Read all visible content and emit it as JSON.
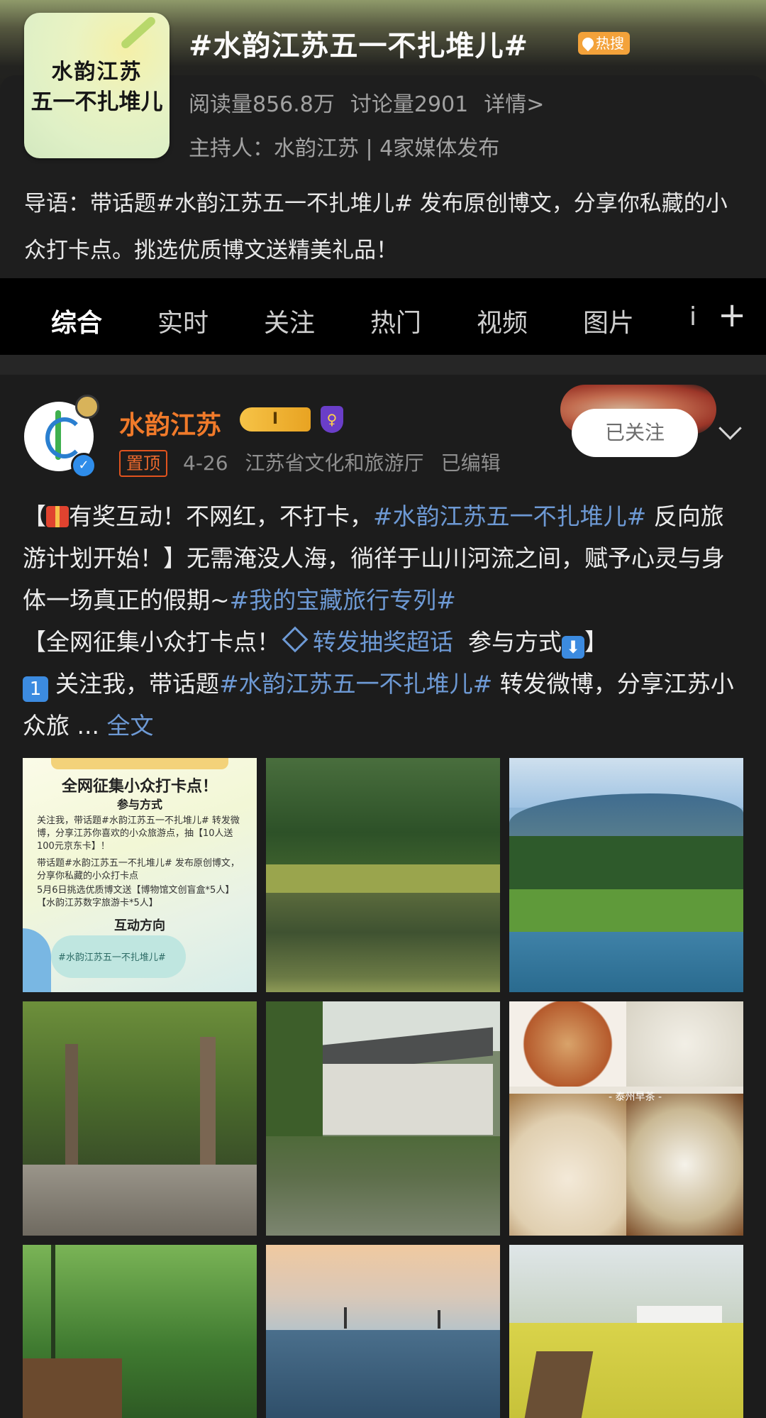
{
  "topic": {
    "cover_line1": "水韵江苏",
    "cover_line2": "五一不扎堆儿",
    "title": "#水韵江苏五一不扎堆儿#",
    "hot_badge": "热搜",
    "reads": "阅读量856.8万",
    "discussions": "讨论量2901",
    "details_link": "详情>",
    "host": "主持人：水韵江苏 | 4家媒体发布",
    "intro": "导语：带话题#水韵江苏五一不扎堆儿# 发布原创博文，分享你私藏的小众打卡点。挑选优质博文送精美礼品！"
  },
  "tabs": [
    {
      "label": "综合",
      "active": true
    },
    {
      "label": "实时"
    },
    {
      "label": "关注"
    },
    {
      "label": "热门"
    },
    {
      "label": "视频"
    },
    {
      "label": "图片"
    },
    {
      "label": "i"
    }
  ],
  "tabs_more": "+",
  "post": {
    "author": "水韵江苏",
    "crown_badge": "I",
    "follow_label": "已关注",
    "pinned_label": "置顶",
    "date": "4-26",
    "source": "江苏省文化和旅游厅",
    "edited": "已编辑",
    "text": {
      "p1_a": "【",
      "p1_b": "有奖互动！不网红，不打卡，",
      "p1_hashtag": "#水韵江苏五一不扎堆儿#",
      "p1_c": " 反向旅游计划开始！】无需淹没人海，徜徉于山川河流之间，赋予心灵与身体一场真正的假期~",
      "p1_hashtag2": "#我的宝藏旅行专列#",
      "p2_a": "【全网征集小众打卡点！",
      "p2_link": "转发抽奖超话",
      "p2_b": "参与方式",
      "p2_c": "】",
      "p3_num": "1",
      "p3_a": "关注我，带话题",
      "p3_hashtag": "#水韵江苏五一不扎堆儿#",
      "p3_b": " 转发微博，分享江苏小众旅 ... ",
      "p3_more": "全文"
    },
    "poster": {
      "title": "全网征集小众打卡点！",
      "subtitle": "参与方式",
      "line1": "关注我，带话题#水韵江苏五一不扎堆儿# 转发微博，分享江苏你喜欢的小众旅游点，抽【10人送100元京东卡】！",
      "line2": "带话题#水韵江苏五一不扎堆儿# 发布原创博文，分享你私藏的小众打卡点",
      "line3": "5月6日挑选优质博文送【博物馆文创盲盒*5人】【水韵江苏数字旅游卡*5人】",
      "head2": "互动方向",
      "bubble": "#水韵江苏五一不扎堆儿#"
    },
    "food_label": "- 泰州早茶 -"
  },
  "colors": {
    "accent_orange": "#f07a2a",
    "link_blue": "#6d99d4",
    "background": "#1c1c1c"
  }
}
